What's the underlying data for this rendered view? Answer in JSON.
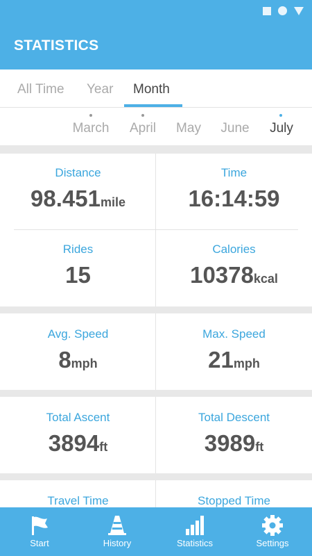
{
  "app": {
    "title": "STATISTICS"
  },
  "tabs": [
    {
      "label": "All Time",
      "active": false
    },
    {
      "label": "Year",
      "active": false
    },
    {
      "label": "Month",
      "active": true
    }
  ],
  "months": [
    {
      "label": "March",
      "dot": true,
      "active": false
    },
    {
      "label": "April",
      "dot": true,
      "active": false
    },
    {
      "label": "May",
      "dot": false,
      "active": false
    },
    {
      "label": "June",
      "dot": false,
      "active": false
    },
    {
      "label": "July",
      "dot": true,
      "active": true
    }
  ],
  "stats": {
    "distance": {
      "label": "Distance",
      "value": "98.451",
      "unit": "mile"
    },
    "time": {
      "label": "Time",
      "value": "16:14:59",
      "unit": ""
    },
    "rides": {
      "label": "Rides",
      "value": "15",
      "unit": ""
    },
    "calories": {
      "label": "Calories",
      "value": "10378",
      "unit": "kcal"
    },
    "avg_speed": {
      "label": "Avg. Speed",
      "value": "8",
      "unit": "mph"
    },
    "max_speed": {
      "label": "Max. Speed",
      "value": "21",
      "unit": "mph"
    },
    "total_ascent": {
      "label": "Total Ascent",
      "value": "3894",
      "unit": "ft"
    },
    "total_descent": {
      "label": "Total Descent",
      "value": "3989",
      "unit": "ft"
    },
    "travel_time": {
      "label": "Travel Time"
    },
    "stopped_time": {
      "label": "Stopped Time"
    }
  },
  "nav": [
    {
      "label": "Start",
      "icon": "flag-icon"
    },
    {
      "label": "History",
      "icon": "traffic-cone-icon"
    },
    {
      "label": "Statistics",
      "icon": "bar-chart-icon",
      "active": true
    },
    {
      "label": "Settings",
      "icon": "gear-icon"
    }
  ],
  "colors": {
    "primary": "#4db0e6",
    "accent_text": "#3ba6dd",
    "value_text": "#555555",
    "inactive_text": "#aaaaaa"
  }
}
